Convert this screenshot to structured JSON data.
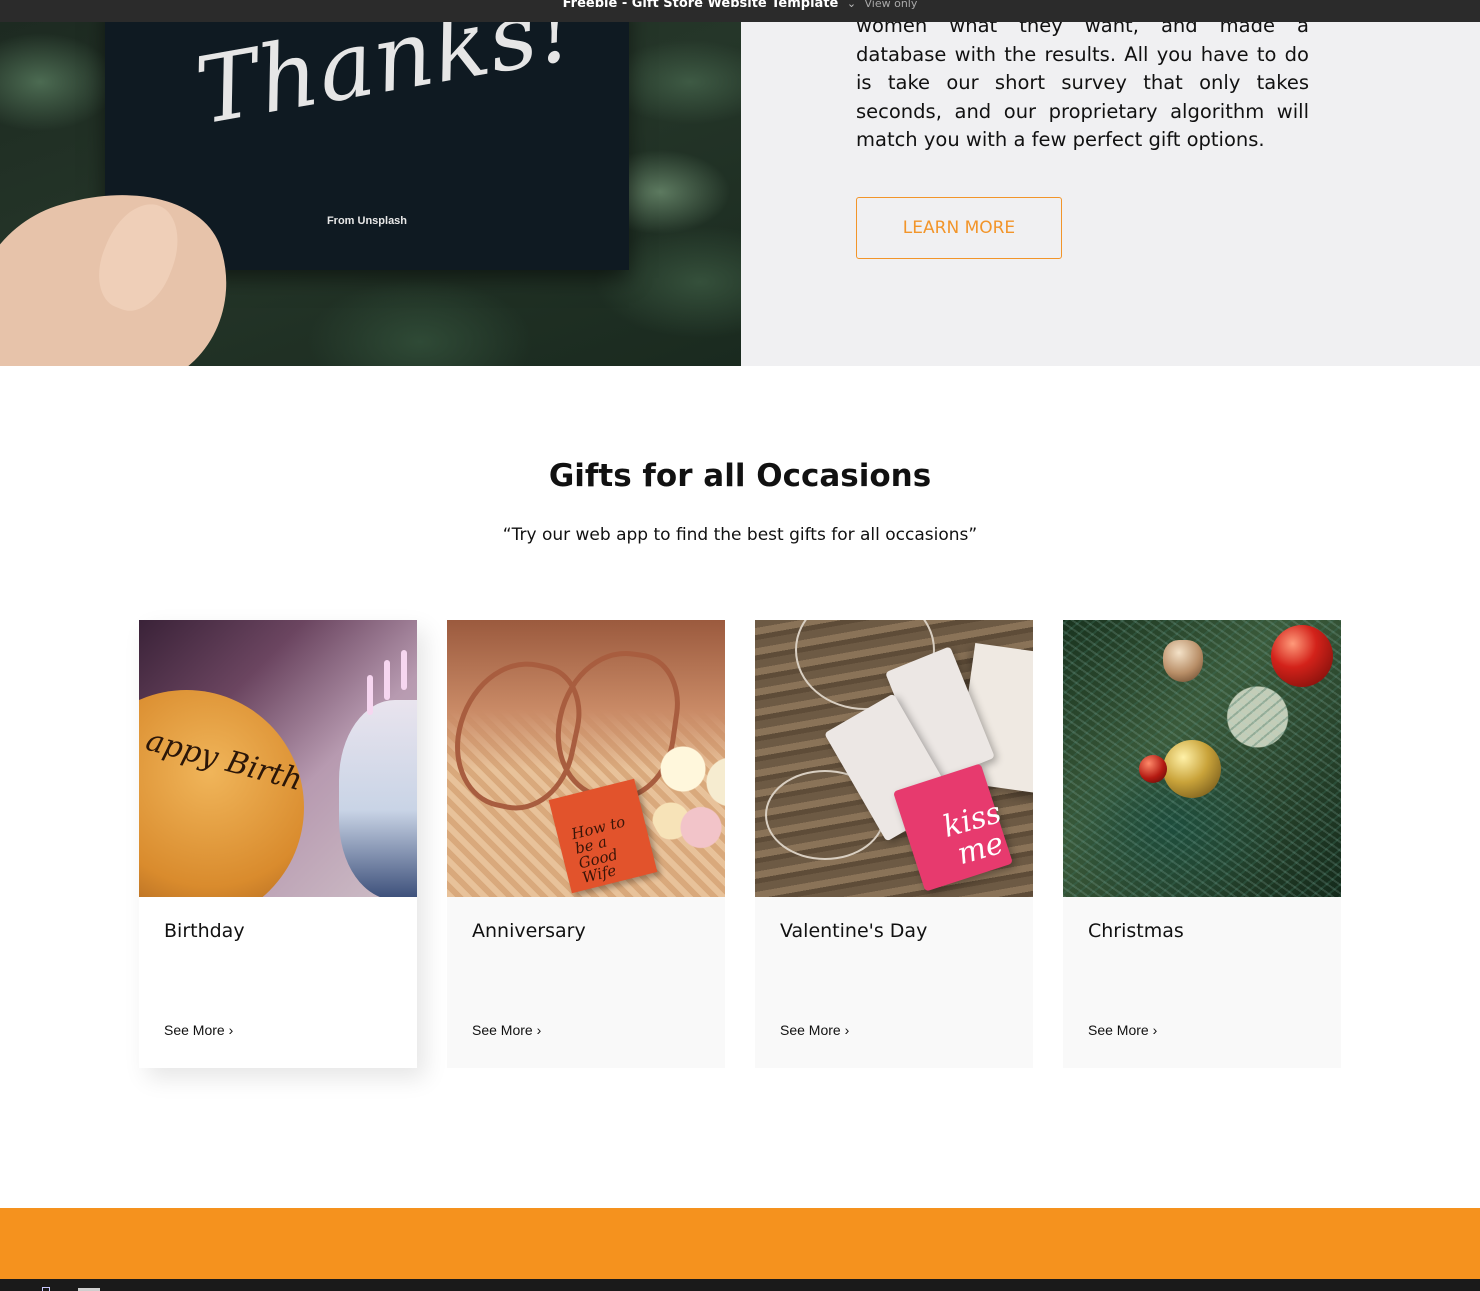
{
  "window": {
    "doc_title": "Freebie - Gift Store Website Template",
    "mode": "View only"
  },
  "hero": {
    "card_text": "Thanks!",
    "photo_credit": "From Unsplash",
    "paragraph": "women what they want, and made a database with the results. All you have to do is take our short survey that only takes seconds, and our proprietary algorithm will match you with a few perfect gift options.",
    "button_label": "LEARN MORE"
  },
  "occasions": {
    "title": "Gifts for all Occasions",
    "subtitle": "“Try our web app to find the best gifts for all occasions”",
    "cards": [
      {
        "label": "Birthday",
        "link": "See More ›",
        "image_text": "appy Birth"
      },
      {
        "label": "Anniversary",
        "link": "See More ›",
        "image_text": "How to be a Good Wife"
      },
      {
        "label": "Valentine's Day",
        "link": "See More ›",
        "image_text": "kiss me"
      },
      {
        "label": "Christmas",
        "link": "See More ›"
      }
    ]
  },
  "colors": {
    "accent": "#f5921e",
    "button_border": "#f2952a",
    "hero_text_bg": "#f0f0f2",
    "card_bg": "#f9f9f9",
    "topbar": "#2b2b2b"
  }
}
